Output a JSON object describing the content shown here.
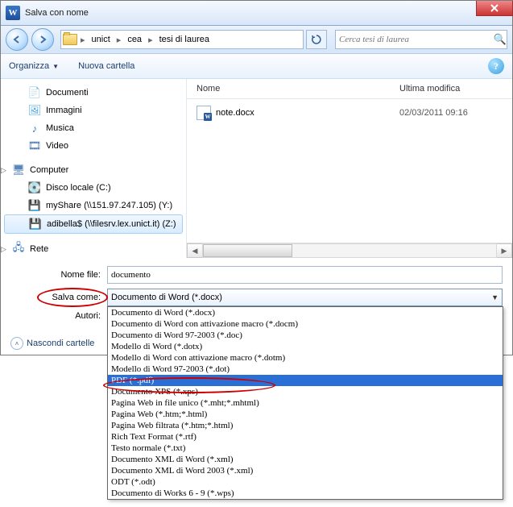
{
  "titlebar": {
    "title": "Salva con nome"
  },
  "breadcrumb": {
    "segs": [
      "unict",
      "cea",
      "tesi di laurea"
    ]
  },
  "search": {
    "placeholder": "Cerca tesi di laurea"
  },
  "toolbar": {
    "organize": "Organizza",
    "newfolder": "Nuova cartella"
  },
  "columns": {
    "name": "Nome",
    "date": "Ultima modifica"
  },
  "files": [
    {
      "name": "note.docx",
      "date": "02/03/2011 09:16"
    }
  ],
  "tree": {
    "libs": [
      "Documenti",
      "Immagini",
      "Musica",
      "Video"
    ],
    "computer": "Computer",
    "drives": [
      "Disco locale (C:)",
      "myShare (\\\\151.97.247.105) (Y:)",
      "adibella$ (\\\\filesrv.lex.unict.it) (Z:)"
    ],
    "network": "Rete"
  },
  "fields": {
    "nome_label": "Nome file:",
    "nome_value": "documento",
    "salva_label": "Salva come:",
    "salva_value": "Documento di Word (*.docx)",
    "autori_label": "Autori:"
  },
  "hide": "Nascondi cartelle",
  "options": [
    "Documento di Word (*.docx)",
    "Documento di Word con attivazione macro (*.docm)",
    "Documento di Word 97-2003 (*.doc)",
    "Modello di Word (*.dotx)",
    "Modello di Word con attivazione macro (*.dotm)",
    "Modello di Word 97-2003 (*.dot)",
    "PDF (*.pdf)",
    "Documento XPS (*.xps)",
    "Pagina Web in file unico (*.mht;*.mhtml)",
    "Pagina Web (*.htm;*.html)",
    "Pagina Web filtrata (*.htm;*.html)",
    "Rich Text Format (*.rtf)",
    "Testo normale (*.txt)",
    "Documento XML di Word (*.xml)",
    "Documento XML di Word 2003 (*.xml)",
    "ODT (*.odt)",
    "Documento di Works 6 - 9 (*.wps)"
  ],
  "selected_option_index": 6
}
